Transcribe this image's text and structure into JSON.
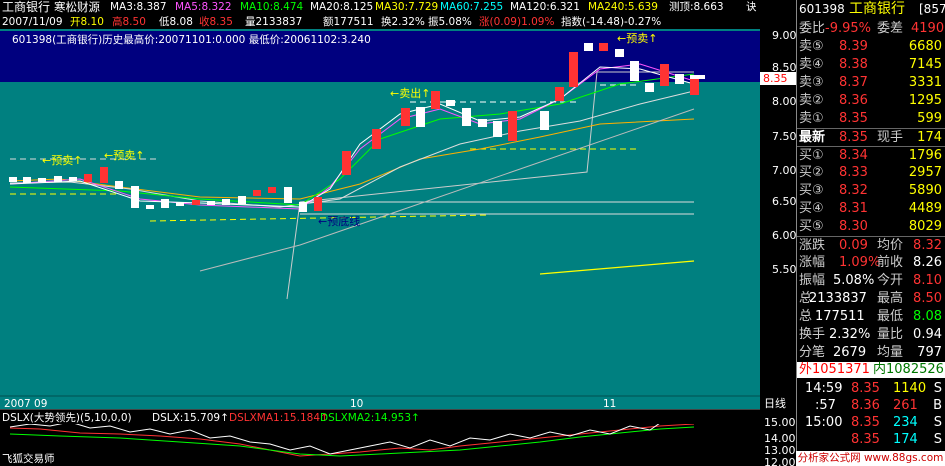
{
  "header": {
    "stock_name": "工商银行",
    "source": "寒松财源",
    "ma3": "MA3:8.387",
    "ma5": "MA5:8.322",
    "ma10": "MA10:8.474",
    "ma20": "MA20:8.125",
    "ma30": "MA30:7.729",
    "ma60": "MA60:7.255",
    "ma120": "MA120:6.321",
    "ma240": "MA240:5.639",
    "predict_top": "测顶:8.663",
    "trailing": "诀"
  },
  "info_bar": {
    "date": "2007/11/09",
    "open": "开8.10",
    "high": "高8.50",
    "low": "低8.08",
    "close": "收8.35",
    "volume": "量2133837",
    "amount": "额177511",
    "turnover": "换2.32%",
    "amplitude": "振5.08%",
    "change": "涨(0.09)1.09%",
    "index": "指数(-14.48)-0.27%"
  },
  "chart_note": "601398(工商银行)历史最高价:20071101:0.000  最低价:20061102:3.240",
  "annotations": {
    "sell_pre1": "←预卖↑",
    "sell_pre2": "←预卖↑",
    "sell_out": "←卖出↑",
    "sell_pre3": "←预卖↑",
    "bottom_line": "←预底线"
  },
  "price_axis": [
    "9.00",
    "8.50",
    "8.00",
    "7.50",
    "7.00",
    "6.50",
    "6.00",
    "5.50"
  ],
  "current_price_tag": "8.35",
  "x_axis": {
    "year_month": "2007 09",
    "oct": "10",
    "nov": "11",
    "period": "日线"
  },
  "indicator": {
    "name": "DSLX(大势领先)(5,10,0,0)",
    "dslx": "DSLX:15.709↑",
    "ma1": "DSLXMA1:15.184↑",
    "ma2": "DSLXMA2:14.953↑",
    "axis": [
      "15.00",
      "14.00",
      "13.00",
      "12.00"
    ],
    "author": "飞狐交易师"
  },
  "quote_panel": {
    "code": "601398",
    "name": "工商银行",
    "suffix": "[857",
    "webi_label": "委比",
    "webi_val": "-9.95%",
    "weicha_label": "委差",
    "weicha_val": "4190",
    "sells": [
      {
        "label": "卖⑤",
        "price": "8.39",
        "vol": "6680"
      },
      {
        "label": "卖④",
        "price": "8.38",
        "vol": "7145"
      },
      {
        "label": "卖③",
        "price": "8.37",
        "vol": "3331"
      },
      {
        "label": "卖②",
        "price": "8.36",
        "vol": "1295"
      },
      {
        "label": "卖①",
        "price": "8.35",
        "vol": "599"
      }
    ],
    "latest_label": "最新",
    "latest_val": "8.35",
    "xianshou_label": "现手",
    "xianshou_val": "174",
    "buys": [
      {
        "label": "买①",
        "price": "8.34",
        "vol": "1796"
      },
      {
        "label": "买②",
        "price": "8.33",
        "vol": "2957"
      },
      {
        "label": "买③",
        "price": "8.32",
        "vol": "5890"
      },
      {
        "label": "买④",
        "price": "8.31",
        "vol": "4489"
      },
      {
        "label": "买⑤",
        "price": "8.30",
        "vol": "8029"
      }
    ],
    "stats": [
      {
        "l1": "涨跌",
        "v1": "0.09",
        "l2": "均价",
        "v2": "8.32"
      },
      {
        "l1": "涨幅",
        "v1": "1.09%",
        "l2": "前收",
        "v2": "8.26"
      },
      {
        "l1": "振幅",
        "v1": "5.08%",
        "l2": "今开",
        "v2": "8.10"
      },
      {
        "l1": "总",
        "v1": "2133837",
        "l2": "最高",
        "v2": "8.50"
      },
      {
        "l1": "总",
        "v1": "177511",
        "l2": "最低",
        "v2": "8.08"
      },
      {
        "l1": "换手",
        "v1": "2.32%",
        "l2": "量比",
        "v2": "0.94"
      },
      {
        "l1": "分笔",
        "v1": "2679",
        "l2": "均量",
        "v2": "797"
      }
    ],
    "outer": "外1051371",
    "inner": "内1082526",
    "ticks": [
      {
        "time": "14:59",
        "price": "8.35",
        "vol": "1140",
        "side": "S"
      },
      {
        "time": ":57",
        "price": "8.36",
        "vol": "261",
        "side": "B"
      },
      {
        "time": "15:00",
        "price": "8.35",
        "vol": "234",
        "side": "S"
      },
      {
        "time": "",
        "price": "8.35",
        "vol": "174",
        "side": "S"
      }
    ],
    "watermark": "分析家公式网 www.88gs.com"
  }
}
